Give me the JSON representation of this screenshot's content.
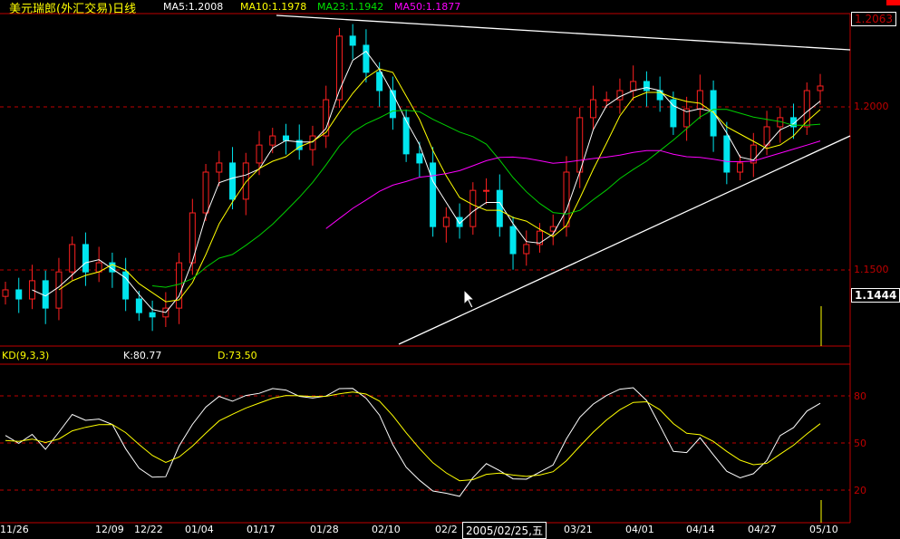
{
  "header": {
    "title": "美元瑞郎(外汇交易)日线",
    "ma5": "MA5:1.2008",
    "ma10": "MA10:1.1978",
    "ma23": "MA23:1.1942",
    "ma50": "MA50:1.1877"
  },
  "kd": {
    "label": "KD(9,3,3)",
    "k": "K:80.77",
    "d": "D:73.50"
  },
  "price_axis": {
    "top": "1.2063",
    "l1": "1.2000",
    "l2": "1.1500",
    "current": "1.1444"
  },
  "kd_axis": {
    "l80": "80",
    "l50": "50",
    "l20": "20"
  },
  "tooltip": "2005/02/25,五",
  "colors": {
    "up": "#ff2020",
    "down": "#00e5ee",
    "ma5": "#ffffff",
    "ma10": "#ffff00",
    "ma23": "#00d000",
    "ma50": "#ff00ff",
    "grid": "#c00000"
  },
  "chart_data": {
    "type": "candlestick",
    "title": "美元瑞郎(外汇交易)日线",
    "xlabels": [
      "11/26",
      "12/09",
      "12/22",
      "01/04",
      "01/17",
      "01/28",
      "02/10",
      "02/2",
      "03/21",
      "04/01",
      "04/14",
      "04/27",
      "05/10"
    ],
    "ylim": [
      1.125,
      1.2267
    ],
    "gridlines": [
      1.2,
      1.15
    ],
    "closes": [
      1.1439,
      1.1411,
      1.1467,
      1.1383,
      1.1494,
      1.1578,
      1.1494,
      1.1522,
      1.1494,
      1.1411,
      1.1369,
      1.1356,
      1.1383,
      1.1522,
      1.1675,
      1.18,
      1.1828,
      1.1717,
      1.1828,
      1.1883,
      1.1911,
      1.1897,
      1.1869,
      1.1911,
      1.2022,
      1.2217,
      1.2189,
      1.2106,
      1.205,
      1.1967,
      1.1856,
      1.1828,
      1.1633,
      1.1661,
      1.1633,
      1.1744,
      1.1744,
      1.1633,
      1.155,
      1.1578,
      1.1619,
      1.1633,
      1.18,
      1.1967,
      1.2022,
      1.2022,
      1.205,
      1.2078,
      1.205,
      1.2022,
      1.1939,
      1.1994,
      1.205,
      1.1911,
      1.18,
      1.1828,
      1.1883,
      1.1939,
      1.1967,
      1.1939,
      1.205,
      1.2064
    ],
    "ma_periods": [
      5,
      10,
      23,
      50
    ],
    "kd_params": [
      9,
      3,
      3
    ],
    "kd_ylim": [
      0,
      100
    ],
    "kd_levels": [
      80,
      50,
      20
    ]
  }
}
